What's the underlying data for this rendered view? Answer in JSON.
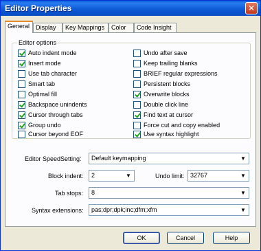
{
  "window": {
    "title": "Editor Properties",
    "close_glyph": "✕"
  },
  "tabs": [
    "General",
    "Display",
    "Key Mappings",
    "Color",
    "Code Insight"
  ],
  "editor_options": {
    "label": "Editor options",
    "left": [
      {
        "label": "Auto indent mode",
        "checked": true
      },
      {
        "label": "Insert mode",
        "checked": true
      },
      {
        "label": "Use tab character",
        "checked": false
      },
      {
        "label": "Smart tab",
        "checked": false
      },
      {
        "label": "Optimal fill",
        "checked": false
      },
      {
        "label": "Backspace unindents",
        "checked": true
      },
      {
        "label": "Cursor through tabs",
        "checked": true
      },
      {
        "label": "Group undo",
        "checked": true
      },
      {
        "label": "Cursor beyond EOF",
        "checked": false
      }
    ],
    "right": [
      {
        "label": "Undo after save",
        "checked": false
      },
      {
        "label": "Keep trailing blanks",
        "checked": false
      },
      {
        "label": "BRIEF regular expressions",
        "checked": false
      },
      {
        "label": "Persistent blocks",
        "checked": false
      },
      {
        "label": "Overwrite blocks",
        "checked": true
      },
      {
        "label": "Double click line",
        "checked": false
      },
      {
        "label": "Find text at cursor",
        "checked": true
      },
      {
        "label": "Force cut and copy enabled",
        "checked": false
      },
      {
        "label": "Use syntax highlight",
        "checked": true
      }
    ]
  },
  "fields": {
    "speedsetting": {
      "label": "Editor SpeedSetting:",
      "value": "Default keymapping"
    },
    "block_indent": {
      "label": "Block indent:",
      "value": "2"
    },
    "undo_limit": {
      "label": "Undo limit:",
      "value": "32767"
    },
    "tab_stops": {
      "label": "Tab stops:",
      "value": "8"
    },
    "syntax_extensions": {
      "label": "Syntax extensions:",
      "value": "pas;dpr;dpk;inc;dfm;xfm"
    }
  },
  "buttons": {
    "ok": "OK",
    "cancel": "Cancel",
    "help": "Help"
  },
  "colors": {
    "title_bar": "#0a5fd8",
    "active_tab_accent": "#e68b2c",
    "check": "#21a121"
  }
}
